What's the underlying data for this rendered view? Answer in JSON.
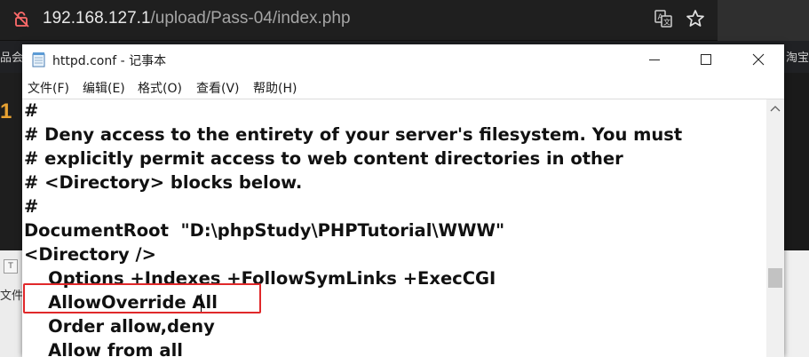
{
  "browser": {
    "url_host": "192.168.127.1",
    "url_path": "/upload/Pass-04/index.php"
  },
  "bookmarks": {
    "left_fragment": "品会",
    "right_fragment": "淘宝"
  },
  "background_page": {
    "file_label": "文件"
  },
  "notepad": {
    "title": "httpd.conf - 记事本",
    "menu": [
      {
        "label": "文件(F)"
      },
      {
        "label": "编辑(E)"
      },
      {
        "label": "格式(O)"
      },
      {
        "label": "查看(V)"
      },
      {
        "label": "帮助(H)"
      }
    ],
    "lines": [
      "#",
      "# Deny access to the entirety of your server's filesystem. You must",
      "# explicitly permit access to web content directories in other",
      "# <Directory> blocks below.",
      "#",
      "DocumentRoot  \"D:\\phpStudy\\PHPTutorial\\WWW\"",
      "<Directory />",
      "    Options +Indexes +FollowSymLinks +ExecCGI",
      "    AllowOverride All",
      "    Order allow,deny",
      "    Allow from all"
    ]
  },
  "colors": {
    "highlight": "#e0282a",
    "browser_bg": "#1f1f1f"
  }
}
